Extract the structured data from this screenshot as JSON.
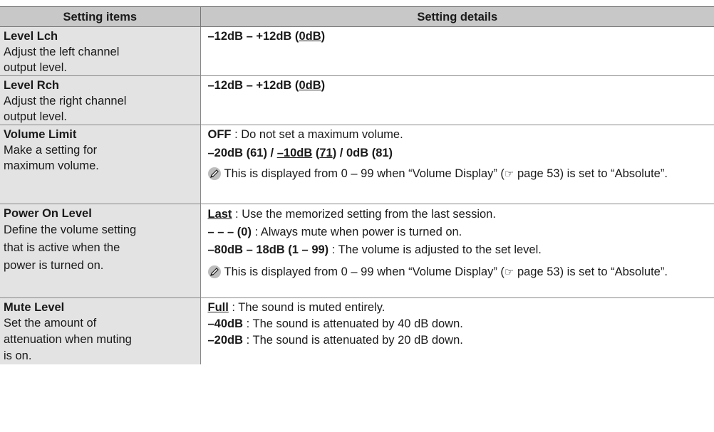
{
  "header": {
    "col1": "Setting items",
    "col2": "Setting details"
  },
  "rows": [
    {
      "title": "Level Lch",
      "desc": [
        "Adjust the left channel",
        "output level."
      ],
      "range_a": "–12dB – +12dB (",
      "range_default": "0dB",
      "range_b": ")"
    },
    {
      "title": "Level Rch",
      "desc": [
        "Adjust the right channel",
        "output level."
      ],
      "range_a": "–12dB – +12dB (",
      "range_default": "0dB",
      "range_b": ")"
    },
    {
      "title": "Volume Limit",
      "desc": [
        "Make a setting for",
        "maximum volume."
      ],
      "off_label": "OFF",
      "off_text": " : Do not set a maximum volume.",
      "opt_a": "–20dB (61) / ",
      "opt_default": "–10dB",
      "opt_b": " (",
      "opt_default_num": "71",
      "opt_c": ") / 0dB (81)",
      "note_a": "This is displayed from 0 – 99 when “Volume Display” (",
      "note_ref": "☞",
      "note_b": " page 53) is set to “Absolute”."
    },
    {
      "title": "Power On Level",
      "desc": [
        "Define the volume setting",
        "that is active when the",
        "power is turned on."
      ],
      "opt1_label": "Last",
      "opt1_text": " : Use the memorized setting from the last session.",
      "opt2_label": "– – – (0)",
      "opt2_text": " : Always mute when power is turned on.",
      "opt3_label": "–80dB – 18dB (1 – 99)",
      "opt3_text": " : The volume is adjusted to the set level.",
      "note_a": "This is displayed from 0 – 99 when “Volume Display” (",
      "note_ref": "☞",
      "note_b": " page 53) is set to “Absolute”."
    },
    {
      "title": "Mute Level",
      "desc": [
        "Set the amount of",
        "attenuation when muting",
        "is on."
      ],
      "opt1_label": "Full",
      "opt1_text": " : The sound is muted entirely.",
      "opt2_label": "–40dB",
      "opt2_text": " : The sound is attenuated by 40 dB down.",
      "opt3_label": "–20dB",
      "opt3_text": " : The sound is attenuated by 20 dB down."
    }
  ]
}
